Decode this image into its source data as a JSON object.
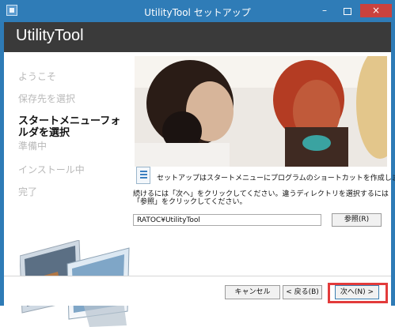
{
  "window": {
    "title": "UtilityTool セットアップ",
    "controls": {
      "minimize": "–",
      "close": "×"
    }
  },
  "header": {
    "title": "UtilityTool"
  },
  "sidebar": {
    "steps": [
      {
        "label": "ようこそ",
        "state": "done"
      },
      {
        "label": "保存先を選択",
        "state": "done"
      },
      {
        "label": "スタートメニューフォルダを選択",
        "state": "active"
      },
      {
        "label": "準備中",
        "state": "pending"
      },
      {
        "label": "インストール中",
        "state": "pending"
      },
      {
        "label": "完了",
        "state": "pending"
      }
    ]
  },
  "content": {
    "info_text": "セットアップはスタートメニューにプログラムのショートカットを作成します。",
    "description": "続けるには「次へ」をクリックしてください。違うディレクトリを選択するには「参照」をクリックしてください。",
    "folder_path": "RATOC¥UtilityTool",
    "browse_label": "参照(R)"
  },
  "footer": {
    "cancel_label": "キャンセル",
    "back_label": "< 戻る(B)",
    "next_label": "次へ(N) >"
  },
  "colors": {
    "titlebar": "#2f7cb7",
    "header": "#3a3a3a",
    "close_button": "#c9423e",
    "highlight": "#e23b3b"
  }
}
